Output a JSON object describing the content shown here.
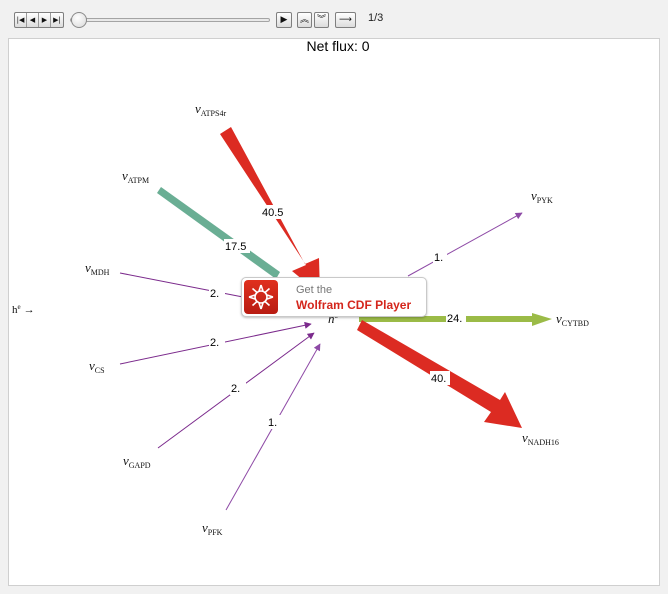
{
  "controls": {
    "playback_icons": [
      "skip-to-start-icon",
      "step-back-icon",
      "step-forward-icon",
      "skip-to-end-icon"
    ],
    "slider_value_fraction": 0.0,
    "play_icon": "play-icon",
    "faster_icon": "faster-icon",
    "slower_icon": "slower-icon",
    "direction_icon": "direction-arrow-icon",
    "frame_counter": "1/3"
  },
  "panel": {
    "title": "Net flux: 0"
  },
  "chart_data": {
    "type": "network",
    "center_node": {
      "label": "h",
      "superscript": "c"
    },
    "orphan_label": {
      "label": "h",
      "superscript": "e",
      "suffix": "→"
    },
    "reactions": [
      {
        "name": "v",
        "sub": "ATPS4r",
        "flux": "40.5",
        "direction": "in",
        "color": "#dc2b22"
      },
      {
        "name": "v",
        "sub": "ATPM",
        "flux": "17.5",
        "direction": "in",
        "color": "#6aae94"
      },
      {
        "name": "v",
        "sub": "MDH",
        "flux": "2.",
        "direction": "in",
        "color": "#7b2a8c"
      },
      {
        "name": "v",
        "sub": "CS",
        "flux": "2.",
        "direction": "in",
        "color": "#7b2a8c"
      },
      {
        "name": "v",
        "sub": "GAPD",
        "flux": "2.",
        "direction": "in",
        "color": "#7b2a8c"
      },
      {
        "name": "v",
        "sub": "PFK",
        "flux": "1.",
        "direction": "in",
        "color": "#8e4aa6"
      },
      {
        "name": "v",
        "sub": "PYK",
        "flux": "1.",
        "direction": "out",
        "color": "#8e4aa6"
      },
      {
        "name": "v",
        "sub": "CYTBD",
        "flux": "24.",
        "direction": "out",
        "color": "#9bbb47"
      },
      {
        "name": "v",
        "sub": "NADH16",
        "flux": "40.",
        "direction": "out",
        "color": "#dc2b22"
      }
    ]
  },
  "cdf_badge": {
    "line1": "Get the",
    "line2": "Wolfram CDF Player",
    "logo_icon": "wolfram-spikey-icon",
    "brand_color": "#d4261c"
  }
}
